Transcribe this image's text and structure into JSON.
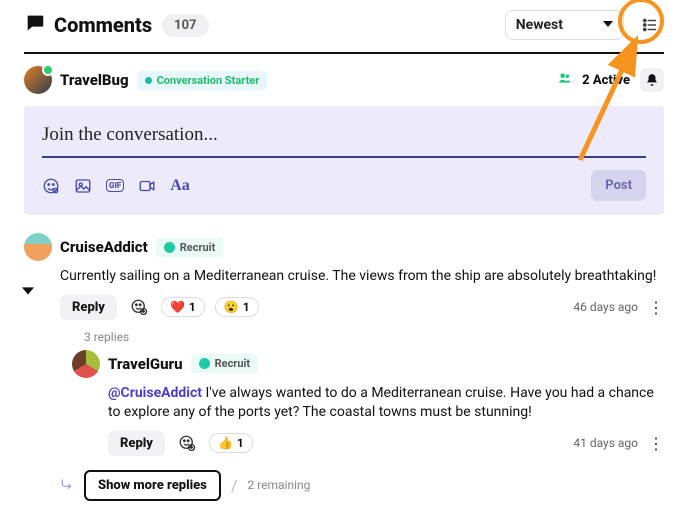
{
  "header": {
    "title": "Comments",
    "count": "107",
    "sort_label": "Newest"
  },
  "top_user": {
    "name": "TravelBug",
    "badge_label": "Conversation Starter",
    "active_label": "2 Active"
  },
  "compose": {
    "placeholder": "Join the conversation...",
    "post_label": "Post",
    "gif_label": "GIF",
    "aa_label": "Aa"
  },
  "comment1": {
    "author": "CruiseAddict",
    "badge": "Recruit",
    "body": "Currently sailing on a Mediterranean cruise. The views from the ship are absolutely breathtaking!",
    "reply_label": "Reply",
    "react_heart": "1",
    "react_wow": "1",
    "age": "46 days ago",
    "replies_count": "3 replies"
  },
  "reply1": {
    "author": "TravelGuru",
    "badge": "Recruit",
    "mention": "@CruiseAddict",
    "body": " I've always wanted to do a Mediterranean cruise. Have you had a chance to explore any of the ports yet? The coastal towns must be stunning!",
    "reply_label": "Reply",
    "react_thumbs": "1",
    "age": "41 days ago"
  },
  "more": {
    "button": "Show more replies",
    "remaining": "2 remaining"
  }
}
